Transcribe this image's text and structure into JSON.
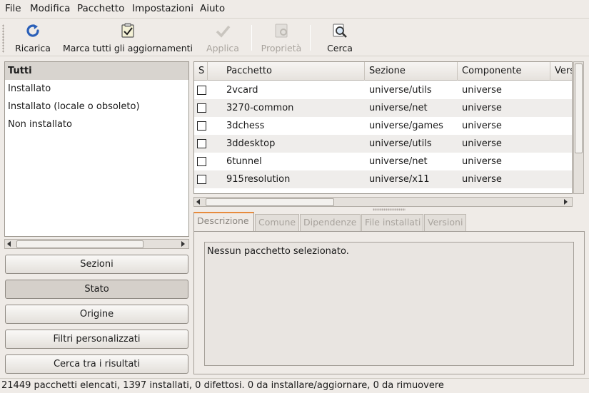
{
  "menubar": {
    "items": [
      "File",
      "Modifica",
      "Pacchetto",
      "Impostazioni",
      "Aiuto"
    ]
  },
  "toolbar": {
    "reload": "Ricarica",
    "mark_all": "Marca tutti gli aggiornamenti",
    "apply": "Applica",
    "properties": "Proprietà",
    "search": "Cerca"
  },
  "filters": {
    "items": [
      "Tutti",
      "Installato",
      "Installato (locale o obsoleto)",
      "Non installato"
    ],
    "selected": "Tutti"
  },
  "side_buttons": {
    "sections": "Sezioni",
    "status": "Stato",
    "origin": "Origine",
    "custom_filters": "Filtri personalizzati",
    "search_results": "Cerca tra i risultati"
  },
  "table": {
    "columns": [
      "S",
      "Pacchetto",
      "Sezione",
      "Componente",
      "Vers"
    ],
    "rows": [
      {
        "package": "2vcard",
        "section": "universe/utils",
        "component": "universe"
      },
      {
        "package": "3270-common",
        "section": "universe/net",
        "component": "universe"
      },
      {
        "package": "3dchess",
        "section": "universe/games",
        "component": "universe"
      },
      {
        "package": "3ddesktop",
        "section": "universe/utils",
        "component": "universe"
      },
      {
        "package": "6tunnel",
        "section": "universe/net",
        "component": "universe"
      },
      {
        "package": "915resolution",
        "section": "universe/x11",
        "component": "universe"
      }
    ]
  },
  "details": {
    "tabs": [
      "Descrizione",
      "Comune",
      "Dipendenze",
      "File installati",
      "Versioni"
    ],
    "active_tab": "Descrizione",
    "description": "Nessun pacchetto selezionato."
  },
  "status": {
    "text": "21449 pacchetti elencati, 1397 installati, 0 difettosi. 0 da installare/aggiornare, 0 da rimuovere"
  }
}
